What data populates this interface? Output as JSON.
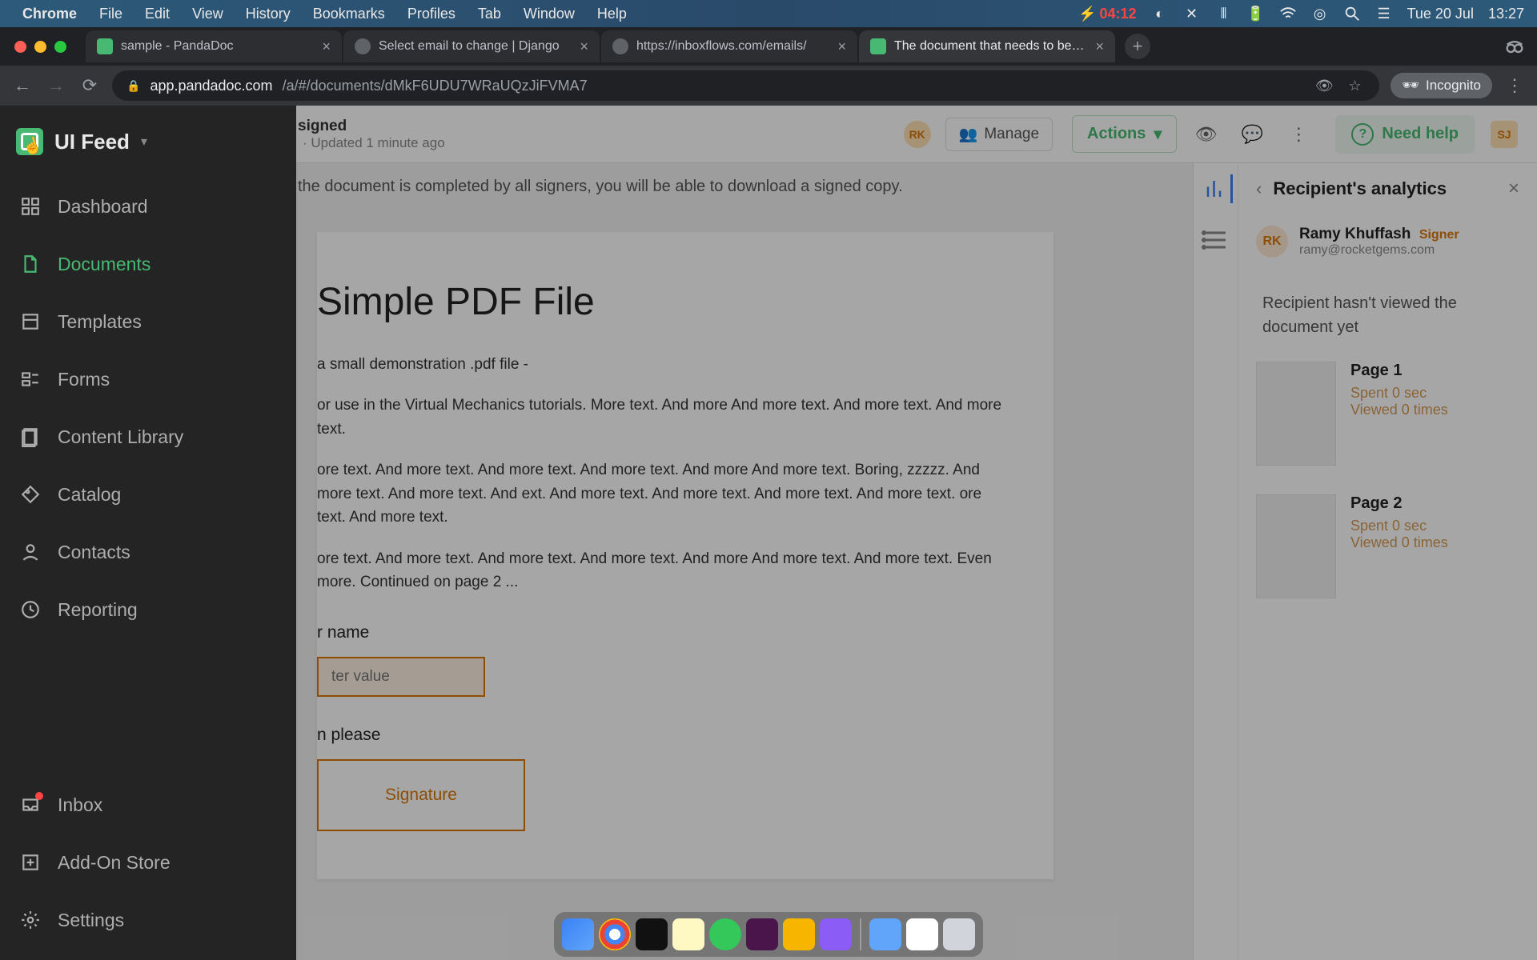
{
  "menubar": {
    "app": "Chrome",
    "items": [
      "File",
      "Edit",
      "View",
      "History",
      "Bookmarks",
      "Profiles",
      "Tab",
      "Window",
      "Help"
    ],
    "battery_time": "04:12",
    "date": "Tue 20 Jul",
    "clock": "13:27"
  },
  "tabs": [
    {
      "title": "sample - PandaDoc",
      "favicon": "pd",
      "active": false
    },
    {
      "title": "Select email to change | Django",
      "favicon": "globe",
      "active": false
    },
    {
      "title": "https://inboxflows.com/emails/",
      "favicon": "globe",
      "active": false
    },
    {
      "title": "The document that needs to be…",
      "favicon": "pd",
      "active": true
    }
  ],
  "address": {
    "prefix": "app.pandadoc.com",
    "rest": "/a/#/documents/dMkF6UDU7WRaUQzJiFVMA7",
    "incognito": "Incognito"
  },
  "sidebar": {
    "workspace": "UI Feed",
    "items": [
      {
        "label": "Dashboard",
        "icon": "grid"
      },
      {
        "label": "Documents",
        "icon": "document",
        "active": true
      },
      {
        "label": "Templates",
        "icon": "template"
      },
      {
        "label": "Forms",
        "icon": "forms"
      },
      {
        "label": "Content Library",
        "icon": "library"
      },
      {
        "label": "Catalog",
        "icon": "tag"
      },
      {
        "label": "Contacts",
        "icon": "contacts"
      },
      {
        "label": "Reporting",
        "icon": "clock"
      }
    ],
    "bottom": [
      {
        "label": "Inbox",
        "icon": "inbox",
        "badge": true
      },
      {
        "label": "Add-On Store",
        "icon": "addon"
      },
      {
        "label": "Settings",
        "icon": "gear"
      }
    ]
  },
  "header": {
    "status": "signed",
    "updated": "· Updated 1 minute ago",
    "avatar_initials": "RK",
    "manage": "Manage",
    "actions": "Actions",
    "need_help": "Need help",
    "user_initials": "SJ"
  },
  "infobar": "the document is completed by all signers, you will be able to download a signed copy.",
  "pdf": {
    "title": "Simple PDF File",
    "p1": "a small demonstration .pdf file -",
    "p2": "or use in the Virtual Mechanics tutorials. More text. And more And more text. And more text. And more text.",
    "p3": "ore text. And more text. And more text. And more text. And more And more text. Boring, zzzzz. And more text. And more text. And ext. And more text. And more text. And more text. And more text. ore text. And more text.",
    "p4": "ore text. And more text. And more text. And more text. And more And more text. And more text. Even more. Continued on page 2 ...",
    "name_label": "r name",
    "name_placeholder": "ter value",
    "sign_label": "n please",
    "signature": "Signature"
  },
  "right_panel": {
    "title": "Recipient's analytics",
    "person": {
      "initials": "RK",
      "name": "Ramy Khuffash",
      "role": "Signer",
      "email": "ramy@rocketgems.com"
    },
    "notice": "Recipient hasn't viewed the document yet",
    "pages": [
      {
        "title": "Page 1",
        "spent": "Spent 0 sec",
        "viewed": "Viewed 0 times"
      },
      {
        "title": "Page 2",
        "spent": "Spent 0 sec",
        "viewed": "Viewed 0 times"
      }
    ]
  },
  "dock": [
    "Finder",
    "Chrome",
    "Terminal",
    "Notes",
    "Messages",
    "Spotify",
    "Sketch",
    "Tool",
    "Folder",
    "Document",
    "Trash"
  ]
}
